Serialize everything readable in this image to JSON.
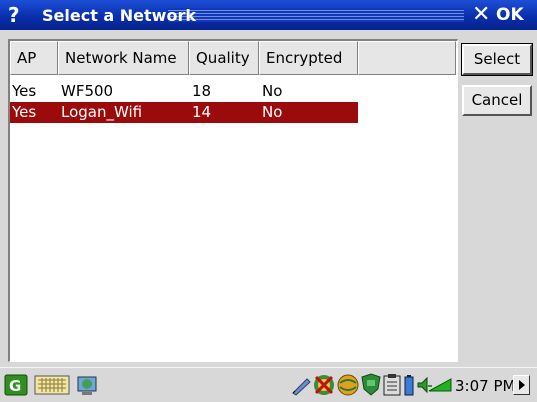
{
  "window": {
    "help": "?",
    "title": "Select a Network",
    "close": "✕",
    "ok": "OK"
  },
  "table": {
    "columns": [
      "AP",
      "Network Name",
      "Quality",
      "Encrypted"
    ],
    "rows": [
      {
        "ap": "Yes",
        "name": "WF500",
        "quality": "18",
        "encrypted": "No",
        "selected": false
      },
      {
        "ap": "Yes",
        "name": "Logan_Wifi",
        "quality": "14",
        "encrypted": "No",
        "selected": true
      }
    ]
  },
  "buttons": {
    "select": "Select",
    "cancel": "Cancel"
  },
  "taskbar": {
    "clock": "3:07 PM",
    "icons": [
      "start-icon",
      "keyboard-icon",
      "network-icon",
      "pen-icon",
      "sync-icon",
      "globe-icon",
      "shield-icon",
      "clipboard-icon",
      "battery-icon",
      "volume-icon",
      "signal-icon"
    ]
  },
  "colors": {
    "title_bar": "#0a2fae",
    "selection": "#9c0b0b"
  }
}
